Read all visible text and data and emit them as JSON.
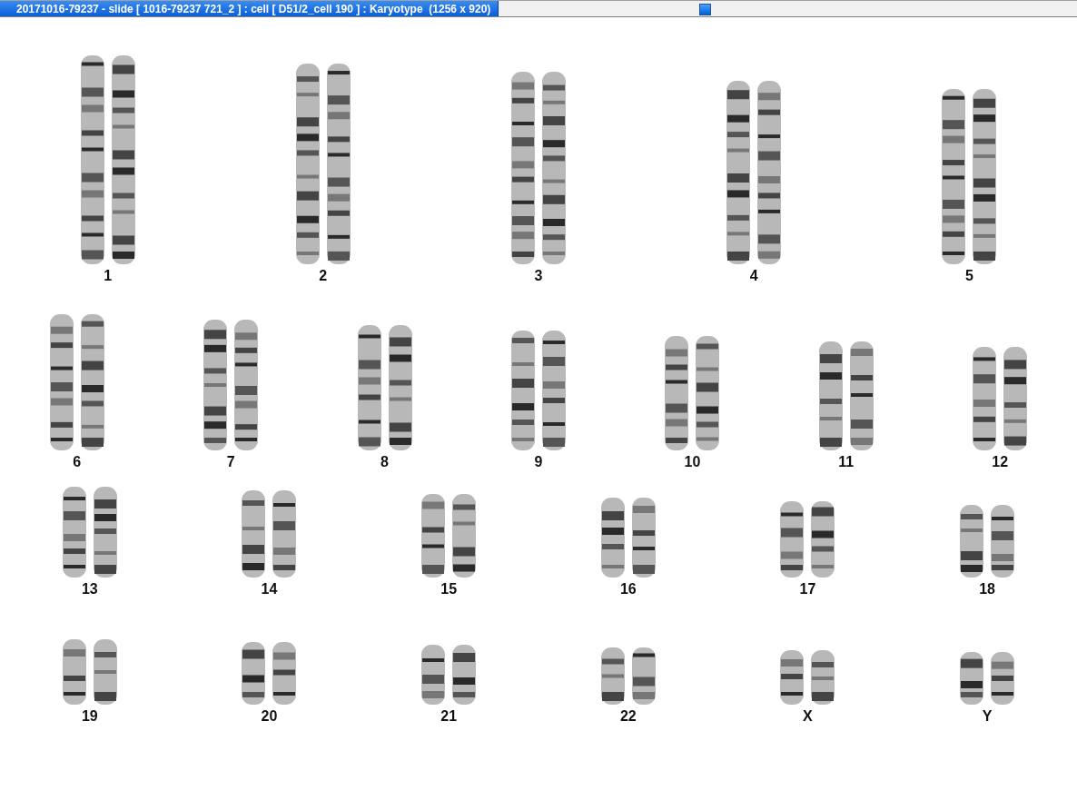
{
  "title_bar": {
    "title": "20171016-79237 - slide [ 1016-79237 721_2 ] : cell [ D51/2_cell 190 ] : Karyotype  (1256 x 920)"
  },
  "karyotype": {
    "rows": [
      {
        "pairs": [
          {
            "label": "1"
          },
          {
            "label": "2"
          },
          {
            "label": "3"
          },
          {
            "label": "4"
          },
          {
            "label": "5"
          }
        ]
      },
      {
        "pairs": [
          {
            "label": "6"
          },
          {
            "label": "7"
          },
          {
            "label": "8"
          },
          {
            "label": "9"
          },
          {
            "label": "10"
          },
          {
            "label": "11"
          },
          {
            "label": "12"
          }
        ]
      },
      {
        "pairs": [
          {
            "label": "13"
          },
          {
            "label": "14"
          },
          {
            "label": "15"
          },
          {
            "label": "16"
          },
          {
            "label": "17"
          },
          {
            "label": "18"
          }
        ]
      },
      {
        "pairs": [
          {
            "label": "19"
          },
          {
            "label": "20"
          },
          {
            "label": "21"
          },
          {
            "label": "22"
          },
          {
            "label": "X"
          },
          {
            "label": "Y"
          }
        ]
      }
    ]
  }
}
